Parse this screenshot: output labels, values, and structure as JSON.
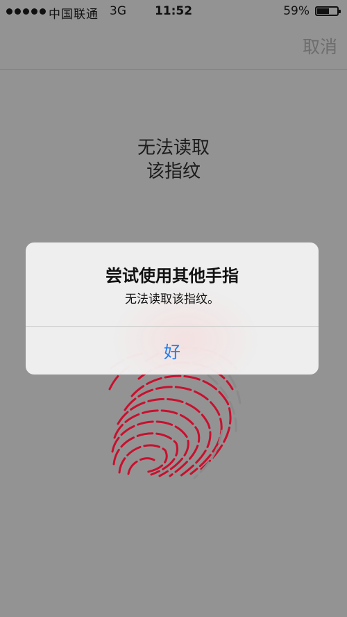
{
  "status_bar": {
    "carrier": "中国联通",
    "network": "3G",
    "time": "11:52",
    "battery_percent_text": "59%",
    "battery_level": 0.59,
    "signal_bars": 5
  },
  "nav": {
    "cancel_label": "取消"
  },
  "main": {
    "message_line1": "无法读取",
    "message_line2": "该指纹"
  },
  "alert": {
    "title": "尝试使用其他手指",
    "message": "无法读取该指纹。",
    "ok_label": "好"
  },
  "colors": {
    "background": "#939393",
    "accent_blue": "#1a7cf5",
    "fingerprint_red": "#c8102e",
    "fingerprint_gray": "#8a8a8a"
  },
  "icons": {
    "fingerprint": "fingerprint-icon",
    "battery": "battery-icon",
    "signal": "signal-strength-icon"
  }
}
